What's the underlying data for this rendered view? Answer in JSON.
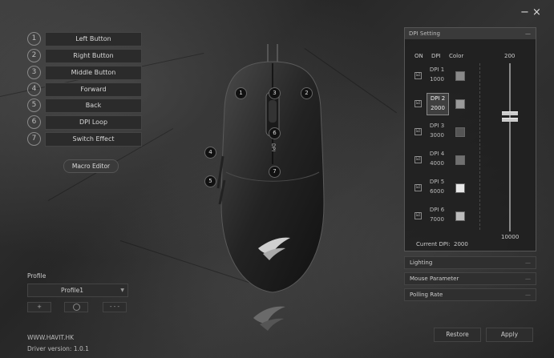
{
  "window": {
    "minimize_icon": "minimize-icon",
    "close_icon": "close-icon",
    "minimize_glyph": "−",
    "close_glyph": "×"
  },
  "buttons": [
    {
      "num": "1",
      "label": "Left Button"
    },
    {
      "num": "2",
      "label": "Right Button"
    },
    {
      "num": "3",
      "label": "Middle Button"
    },
    {
      "num": "4",
      "label": "Forward"
    },
    {
      "num": "5",
      "label": "Back"
    },
    {
      "num": "6",
      "label": "DPI Loop"
    },
    {
      "num": "7",
      "label": "Switch Effect"
    }
  ],
  "macro_label": "Macro Editor",
  "mouse_labels": [
    "1",
    "3",
    "2",
    "6",
    "7",
    "4",
    "5"
  ],
  "mouse_dpi_text": "DPI",
  "profile": {
    "label": "Profile",
    "value": "Profile1",
    "add": "+",
    "remove": "-",
    "more": "- - -"
  },
  "footer": {
    "url": "WWW.HAVIT.HK",
    "version": "Driver version: 1.0.1"
  },
  "dpi_panel": {
    "title": "DPI Setting",
    "collapse": "—",
    "columns": {
      "on": "ON",
      "dpi": "DPI",
      "color": "Color"
    },
    "rows": [
      {
        "name": "DPI 1",
        "value": "1000",
        "checked": "☑",
        "color": "#8a8a8a"
      },
      {
        "name": "DPI 2",
        "value": "2000",
        "checked": "☑",
        "color": "#9a9a9a"
      },
      {
        "name": "DPI 3",
        "value": "3000",
        "checked": "☑",
        "color": "#555555"
      },
      {
        "name": "DPI 4",
        "value": "4000",
        "checked": "☑",
        "color": "#707070"
      },
      {
        "name": "DPI 5",
        "value": "6000",
        "checked": "☑",
        "color": "#e8e8e8"
      },
      {
        "name": "DPI 6",
        "value": "7000",
        "checked": "☑",
        "color": "#bcbcbc"
      }
    ],
    "slider_max_label": "200",
    "slider_min_label": "10000",
    "current_label": "Current DPI:",
    "current_value": "2000"
  },
  "sections": [
    {
      "label": "Lighting",
      "icon": "—"
    },
    {
      "label": "Mouse Parameter",
      "icon": "—"
    },
    {
      "label": "Polling Rate",
      "icon": "—"
    }
  ],
  "actions": {
    "restore": "Restore",
    "apply": "Apply"
  }
}
